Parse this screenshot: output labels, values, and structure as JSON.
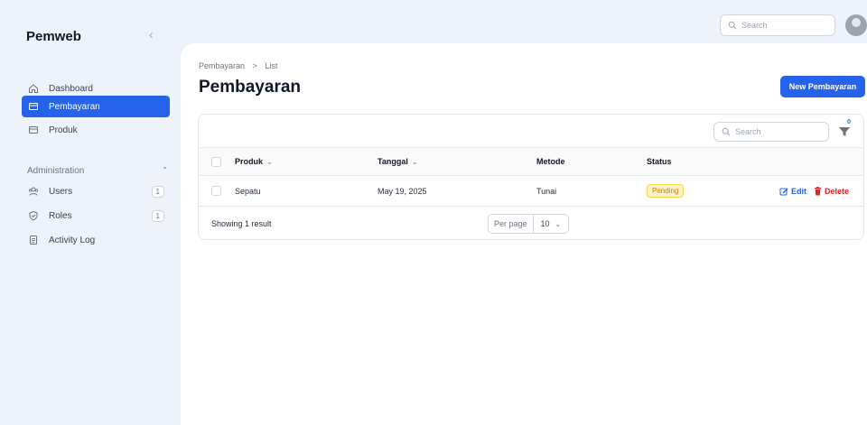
{
  "sidebar": {
    "brand": "Pemweb",
    "items": [
      {
        "label": "Dashboard",
        "icon": "home-icon"
      },
      {
        "label": "Pembayaran",
        "icon": "card-icon",
        "active": true
      },
      {
        "label": "Produk",
        "icon": "card-icon"
      }
    ],
    "group": {
      "label": "Administration",
      "items": [
        {
          "label": "Users",
          "badge": "1",
          "icon": "users-icon"
        },
        {
          "label": "Roles",
          "badge": "1",
          "icon": "shield-check-icon"
        },
        {
          "label": "Activity Log",
          "icon": "clipboard-icon"
        }
      ]
    }
  },
  "topbar": {
    "search_placeholder": "Search"
  },
  "page": {
    "breadcrumb": [
      "Pembayaran",
      "List"
    ],
    "breadcrumb_sep": ">",
    "title": "Pembayaran",
    "new_button": "New Pembayaran"
  },
  "table": {
    "search_placeholder": "Search",
    "filter_count": "0",
    "columns": [
      "Produk",
      "Tanggal",
      "Metode",
      "Status"
    ],
    "rows": [
      {
        "produk": "Sepatu",
        "tanggal": "May 19, 2025",
        "metode": "Tunai",
        "status": "Pending"
      }
    ],
    "edit_label": "Edit",
    "delete_label": "Delete",
    "footer": {
      "showing": "Showing 1 result",
      "per_page_label": "Per page",
      "per_page_value": "10"
    }
  },
  "colors": {
    "accent": "#2563eb",
    "danger": "#dc2626",
    "pending": "#d97706"
  }
}
